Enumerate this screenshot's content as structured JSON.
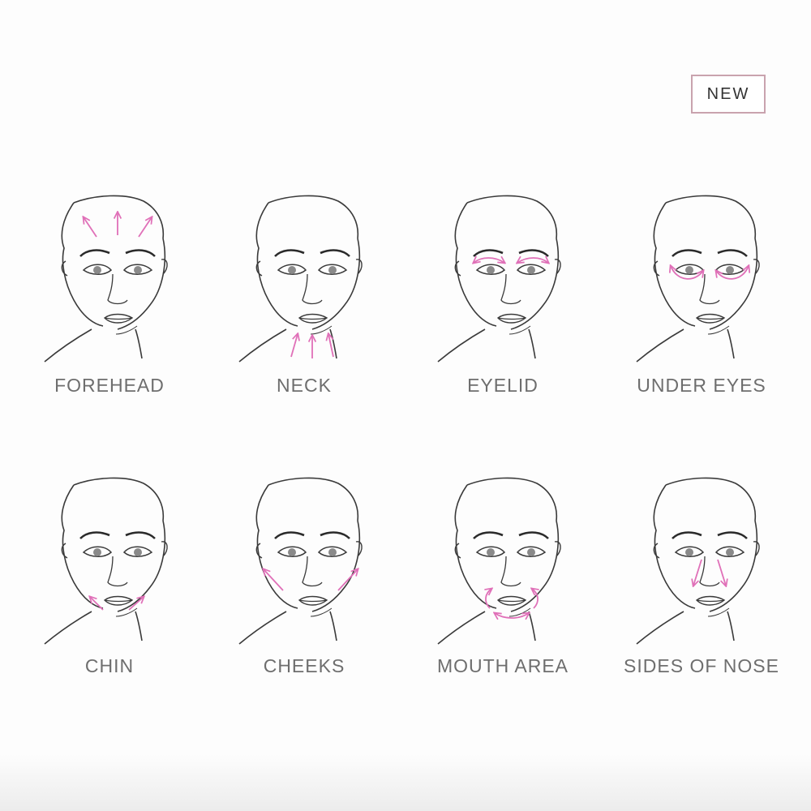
{
  "badge": {
    "text": "NEW"
  },
  "colors": {
    "arrow": "#e070b8",
    "line": "#3a3a3a",
    "label": "#6e6e6e",
    "badge_border": "#c9a3ae"
  },
  "areas": [
    {
      "label": "FOREHEAD",
      "arrow_icon": "up-arrows-icon"
    },
    {
      "label": "NECK",
      "arrow_icon": "up-arrows-icon"
    },
    {
      "label": "EYELID",
      "arrow_icon": "curved-arrows-icon"
    },
    {
      "label": "UNDER EYES",
      "arrow_icon": "curved-arrows-icon"
    },
    {
      "label": "CHIN",
      "arrow_icon": "diagonal-arrows-icon"
    },
    {
      "label": "CHEEKS",
      "arrow_icon": "diagonal-arrows-icon"
    },
    {
      "label": "MOUTH AREA",
      "arrow_icon": "curved-arrows-icon"
    },
    {
      "label": "SIDES OF NOSE",
      "arrow_icon": "down-arrows-icon"
    }
  ]
}
